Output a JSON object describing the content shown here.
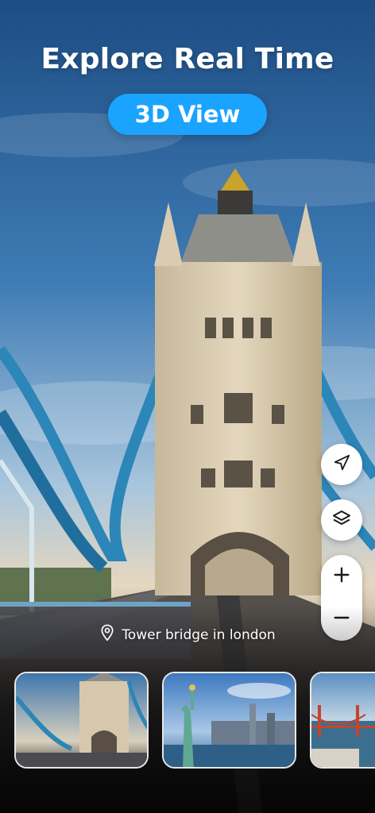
{
  "hero": {
    "title": "Explore Real Time",
    "badge": "3D View",
    "scene": "tower-bridge-london"
  },
  "location": {
    "icon": "map-pin-icon",
    "label": "Tower bridge in london"
  },
  "controls": {
    "locate_icon": "navigation-arrow-icon",
    "layers_icon": "layers-icon",
    "zoom_in_icon": "plus-icon",
    "zoom_out_icon": "minus-icon"
  },
  "thumbnails": [
    {
      "scene": "tower-bridge"
    },
    {
      "scene": "statue-of-liberty"
    },
    {
      "scene": "golden-gate-bridge"
    }
  ],
  "colors": {
    "accent": "#1aa3ff",
    "text": "#ffffff",
    "control_bg": "#ffffff",
    "icon": "#1a1a1a"
  }
}
